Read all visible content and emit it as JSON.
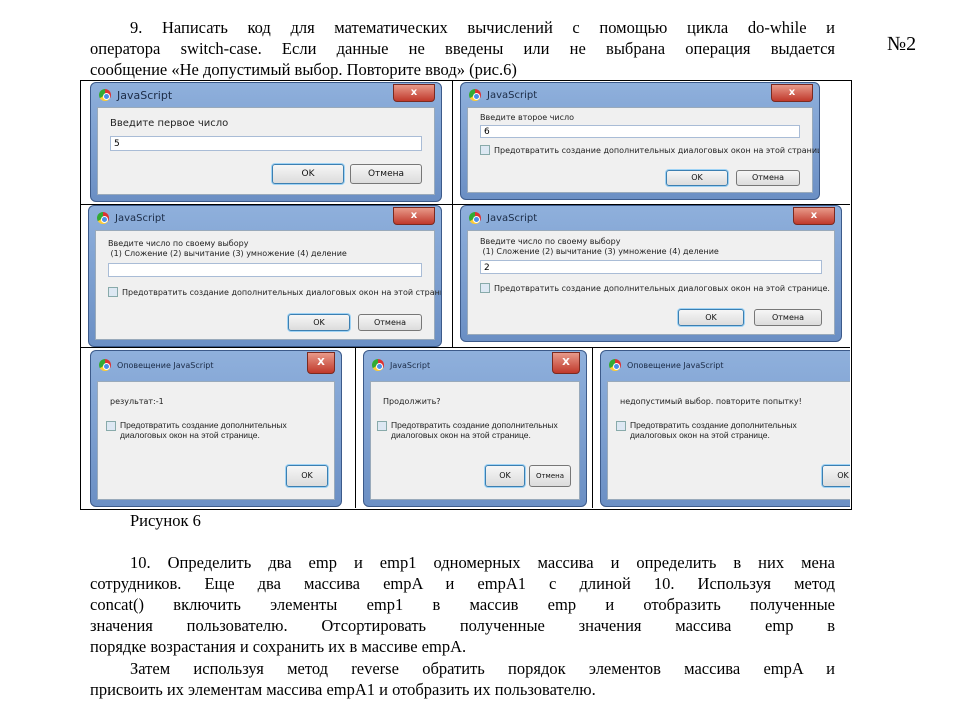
{
  "task9": {
    "lines": [
      "9. Написать код для математических вычислений с помощью цикла do-while и",
      "оператора switch-case. Если данные не введены или не выбрана операция выдается",
      "сообщение «Не допустимый выбор. Повторите ввод» (рис.6)"
    ]
  },
  "page_number": "№2",
  "dialogs": [
    {
      "title": "JavaScript",
      "close": "x",
      "message": "Введите первое число",
      "input": "5",
      "ok": "OK",
      "cancel": "Отмена"
    },
    {
      "title": "JavaScript",
      "close": "x",
      "message": "Введите второе число",
      "input": "6",
      "checkbox": "Предотвратить создание дополнительных диалоговых окон на этой странице.",
      "ok": "OK",
      "cancel": "Отмена"
    },
    {
      "title": "JavaScript",
      "close": "x",
      "message": "Введите число по своему выбору\n (1) Сложение (2) вычитание (3) умножение (4) деление",
      "input": "",
      "checkbox": "Предотвратить создание дополнительных диалоговых окон на этой странице.",
      "ok": "OK",
      "cancel": "Отмена"
    },
    {
      "title": "JavaScript",
      "close": "x",
      "message": "Введите число по своему выбору\n (1) Сложение (2) вычитание (3) умножение (4) деление",
      "input": "2",
      "checkbox": "Предотвратить создание дополнительных диалоговых окон на этой странице.",
      "ok": "OK",
      "cancel": "Отмена"
    },
    {
      "title": "Оповещение JavaScript",
      "close": "X",
      "message": "результат:-1",
      "checkbox": "Предотвратить создание дополнительных диалоговых окон на этой странице.",
      "ok": "OK"
    },
    {
      "title": "JavaScript",
      "close": "X",
      "message": "Продолжить?",
      "checkbox": "Предотвратить создание дополнительных диалоговых окон на этой странице.",
      "ok": "OK",
      "cancel": "Отмена"
    },
    {
      "title": "Оповещение JavaScript",
      "close": "X",
      "message": "недопустимый выбор. повторите попытку!",
      "checkbox": "Предотвратить создание дополнительных диалоговых окон на этой странице.",
      "ok": "OK"
    }
  ],
  "figure_caption": "Рисунок 6",
  "task10": {
    "lines": [
      "10. Определить два emp и emp1 одномерных массива и определить в них мена",
      "сотрудников. Еще два массива empA и empA1 с длиной 10. Используя метод",
      "concat() включить элементы emp1 в массив emp и отобразить полученные",
      "значения пользователю. Отсортировать полученные значения массива emp в",
      "порядке возрастания и сохранить их в массиве empA.",
      "Затем используя метод reverse обратить порядок элементов массива empA и",
      "присвоить их элементам массива empA1 и отобразить их пользователю."
    ]
  }
}
